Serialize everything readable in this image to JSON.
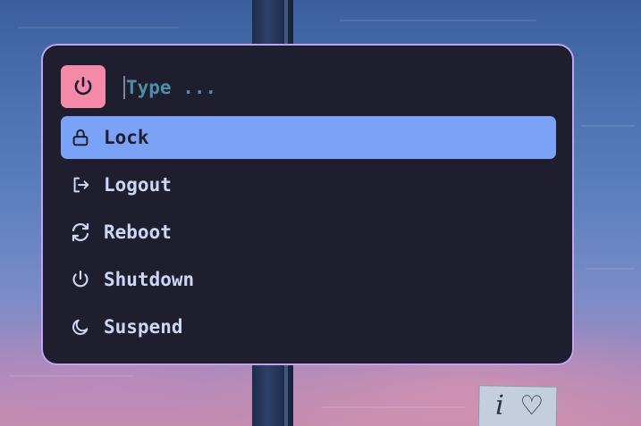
{
  "launcher": {
    "prompt_icon": "power-icon",
    "search": {
      "placeholder": "Type ...",
      "value": ""
    },
    "items": [
      {
        "label": "Lock",
        "icon": "lock-icon",
        "selected": true
      },
      {
        "label": "Logout",
        "icon": "logout-icon",
        "selected": false
      },
      {
        "label": "Reboot",
        "icon": "reboot-icon",
        "selected": false
      },
      {
        "label": "Shutdown",
        "icon": "power-icon",
        "selected": false
      },
      {
        "label": "Suspend",
        "icon": "moon-icon",
        "selected": false
      }
    ]
  },
  "wallpaper": {
    "sign_text": "i ♡"
  },
  "colors": {
    "background": "#1e1e2e",
    "border": "#c0a4f0",
    "selected": "#7aa2f7",
    "prompt_icon_bg": "#f38ba8",
    "text": "#cdd6f4",
    "placeholder": "#4b8fa8"
  }
}
